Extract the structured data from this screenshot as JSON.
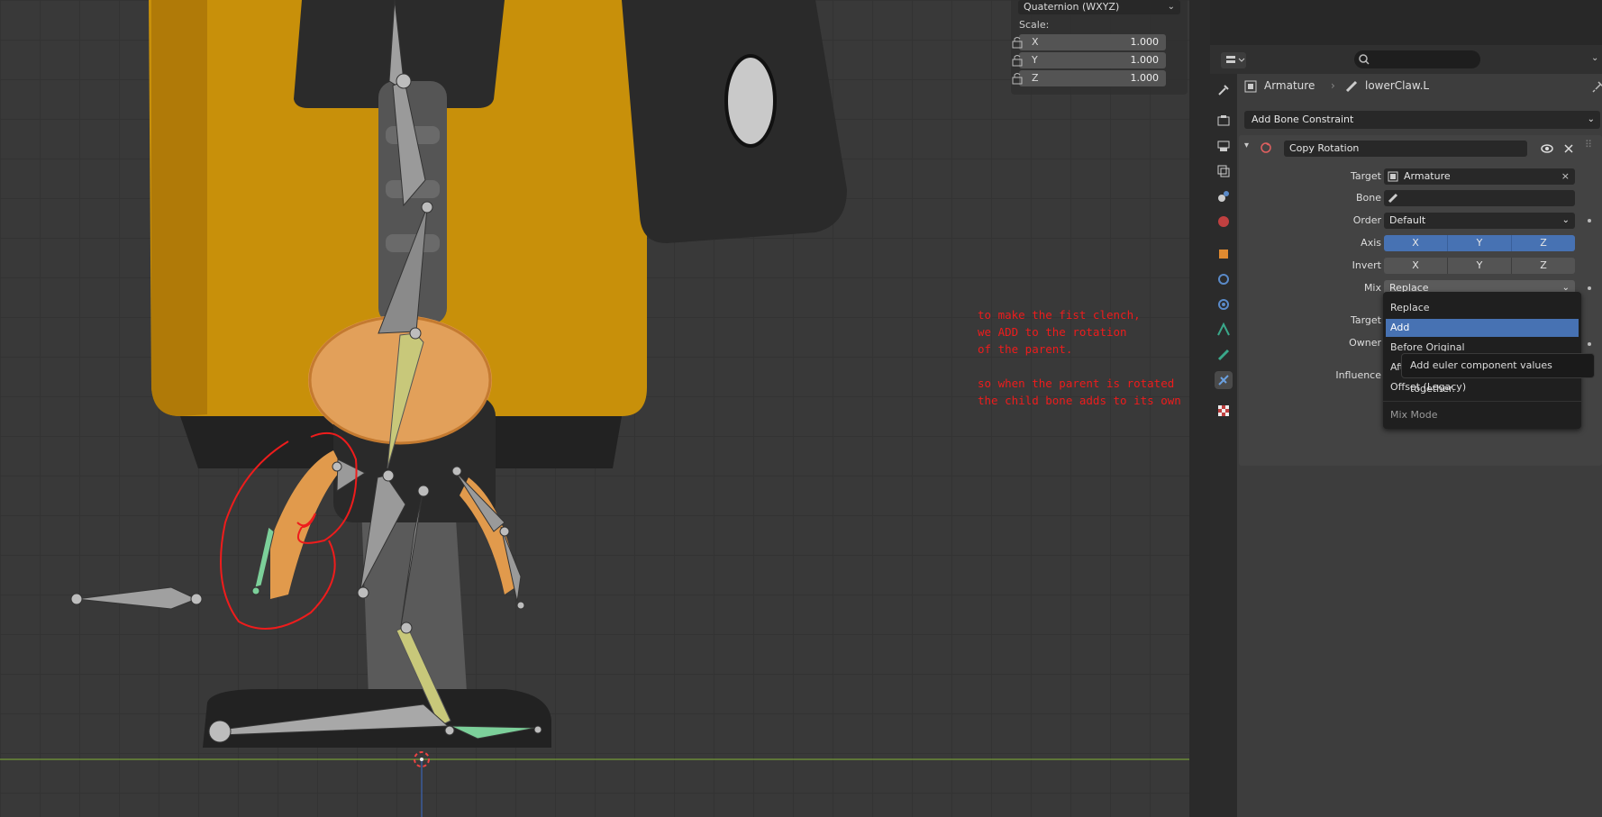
{
  "viewport": {
    "annotation_lines": [
      "to make the fist clench,",
      "we ADD to the rotation",
      "of the parent.",
      "",
      "so when the parent is rotated",
      "the child bone adds to its own rotation"
    ]
  },
  "npanel": {
    "rotation_mode": "Quaternion (WXYZ)",
    "scale_label": "Scale:",
    "scale": [
      {
        "axis": "X",
        "value": "1.000"
      },
      {
        "axis": "Y",
        "value": "1.000"
      },
      {
        "axis": "Z",
        "value": "1.000"
      }
    ]
  },
  "properties": {
    "breadcrumb": {
      "object": "Armature",
      "bone": "lowerClaw.L"
    },
    "add_constraint_label": "Add Bone Constraint",
    "constraint": {
      "name": "Copy Rotation",
      "target_label": "Target",
      "target_value": "Armature",
      "bone_label": "Bone",
      "bone_value": "",
      "order_label": "Order",
      "order_value": "Default",
      "axis_label": "Axis",
      "axis_buttons": [
        "X",
        "Y",
        "Z"
      ],
      "invert_label": "Invert",
      "invert_buttons": [
        "X",
        "Y",
        "Z"
      ],
      "mix_label": "Mix",
      "mix_value": "Replace",
      "target_space_label": "Target",
      "owner_space_label": "Owner",
      "influence_label": "Influence"
    }
  },
  "mix_dropdown": {
    "items": [
      "Replace",
      "Add",
      "Before Original",
      "After Original",
      "Offset (Legacy)"
    ],
    "selected": "Add",
    "title": "Mix Mode"
  },
  "tooltip": "Add euler component values together.",
  "colors": {
    "accent": "#4772b3",
    "annotation": "#ee1c1c"
  }
}
